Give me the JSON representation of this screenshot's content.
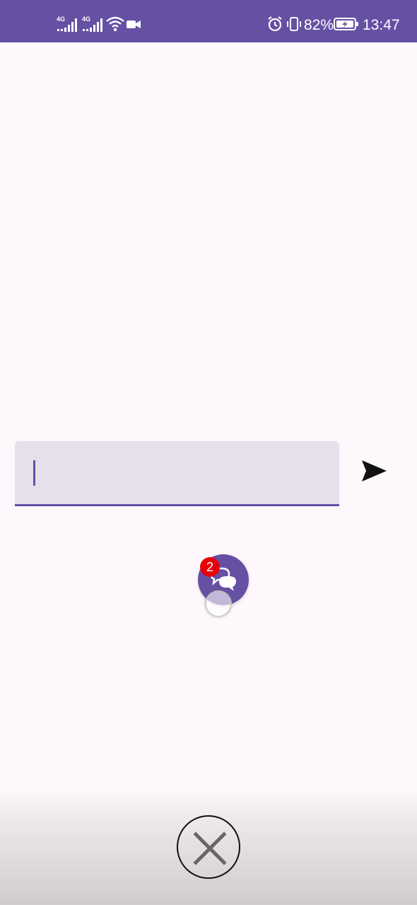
{
  "status_bar": {
    "signal1_label": "4G",
    "signal2_label": "4G",
    "battery_percent": "82%",
    "time": "13:47",
    "icons": [
      "signal-4g-icon",
      "signal-4g-icon",
      "wifi-icon",
      "video-camera-icon",
      "alarm-icon",
      "vibrate-icon",
      "battery-charging-icon"
    ]
  },
  "composer": {
    "input_value": "",
    "placeholder": "",
    "send_icon": "send-icon"
  },
  "chat_head": {
    "icon": "chat-bubbles-icon",
    "badge_count": "2"
  },
  "dismiss": {
    "icon": "close-icon"
  },
  "colors": {
    "primary": "#6650a4",
    "field_bg": "#e7e0ec",
    "background": "#fef7fb",
    "badge": "#e8000b"
  }
}
